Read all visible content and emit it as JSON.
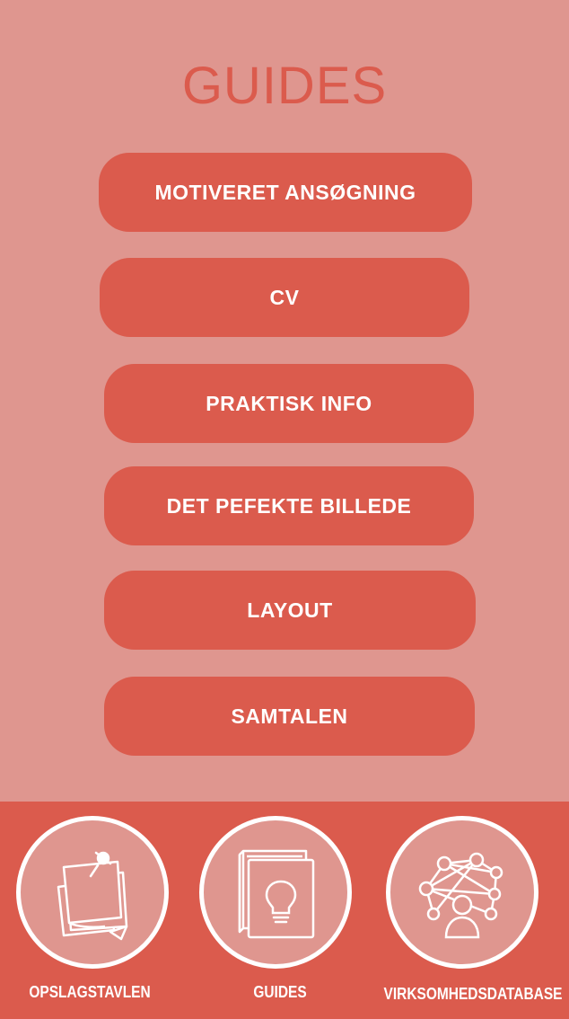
{
  "title": "GUIDES",
  "colors": {
    "background": "#df968f",
    "accent": "#db5b4d",
    "text_on_accent": "#ffffff"
  },
  "guides": [
    {
      "label": "MOTIVERET ANSØGNING"
    },
    {
      "label": "CV"
    },
    {
      "label": "PRAKTISK INFO"
    },
    {
      "label": "DET PEFEKTE BILLEDE"
    },
    {
      "label": "LAYOUT"
    },
    {
      "label": "SAMTALEN"
    }
  ],
  "bottom_nav": [
    {
      "label": "OPSLAGSTAVLEN",
      "icon": "sticky-notes-icon"
    },
    {
      "label": "GUIDES",
      "icon": "book-lightbulb-icon"
    },
    {
      "label": "VIRKSOMHEDSDATABASE",
      "icon": "network-person-icon"
    }
  ]
}
